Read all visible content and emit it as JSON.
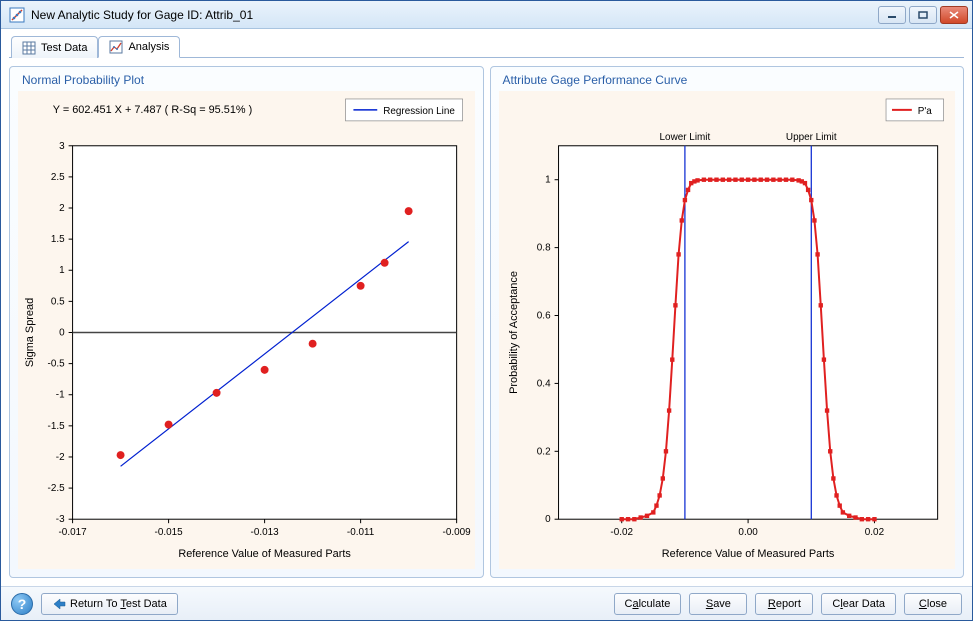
{
  "window": {
    "title": "New Analytic Study for Gage ID:  Attrib_01"
  },
  "tabs": {
    "test_data": "Test Data",
    "analysis": "Analysis"
  },
  "left_panel": {
    "title": "Normal Probability Plot",
    "equation": "Y =  602.451 X + 7.487  ( R-Sq = 95.51% )",
    "legend_label": "Regression Line",
    "xlabel": "Reference Value of Measured Parts",
    "ylabel": "Sigma Spread"
  },
  "right_panel": {
    "title": "Attribute Gage Performance Curve",
    "legend_label": "P'a",
    "xlabel": "Reference Value of Measured Parts",
    "ylabel": "Probability of Acceptance",
    "lower_limit_label": "Lower Limit",
    "upper_limit_label": "Upper Limit"
  },
  "buttons": {
    "return": "Return To Test Data",
    "calculate": "Calculate",
    "save": "Save",
    "report": "Report",
    "clear_data": "Clear Data",
    "close": "Close"
  },
  "chart_data": [
    {
      "type": "scatter",
      "title": "Normal Probability Plot",
      "xlabel": "Reference Value of Measured Parts",
      "ylabel": "Sigma Spread",
      "xlim": [
        -0.017,
        -0.009
      ],
      "ylim": [
        -3,
        3
      ],
      "xticks": [
        -0.017,
        -0.015,
        -0.013,
        -0.011,
        -0.009
      ],
      "yticks": [
        -3,
        -2.5,
        -2,
        -1.5,
        -1,
        -0.5,
        0,
        0.5,
        1,
        1.5,
        2,
        2.5,
        3
      ],
      "series": [
        {
          "name": "Regression Line",
          "type": "line",
          "color": "#0020d0",
          "x": [
            -0.016,
            -0.01
          ],
          "y": [
            -2.15,
            1.46
          ]
        },
        {
          "name": "Points",
          "type": "scatter",
          "color": "#e02020",
          "x": [
            -0.016,
            -0.015,
            -0.014,
            -0.013,
            -0.012,
            -0.011,
            -0.0105,
            -0.01
          ],
          "y": [
            -1.97,
            -1.48,
            -0.97,
            -0.6,
            -0.18,
            0.75,
            1.12,
            1.95
          ]
        },
        {
          "name": "zero-line",
          "type": "hline",
          "color": "#444444",
          "y": 0
        }
      ],
      "equation": "Y = 602.451 X + 7.487 (R-Sq = 95.51%)"
    },
    {
      "type": "line",
      "title": "Attribute Gage Performance Curve",
      "xlabel": "Reference Value of Measured Parts",
      "ylabel": "Probability of Acceptance",
      "xlim": [
        -0.03,
        0.03
      ],
      "ylim": [
        0,
        1.1
      ],
      "xticks": [
        -0.02,
        0.0,
        0.02
      ],
      "yticks": [
        0,
        0.2,
        0.4,
        0.6,
        0.8,
        1
      ],
      "lower_limit": -0.01,
      "upper_limit": 0.01,
      "series": [
        {
          "name": "P'a",
          "color": "#e02020",
          "x": [
            -0.02,
            -0.019,
            -0.018,
            -0.017,
            -0.016,
            -0.015,
            -0.0145,
            -0.014,
            -0.0135,
            -0.013,
            -0.0125,
            -0.012,
            -0.0115,
            -0.011,
            -0.0105,
            -0.01,
            -0.0095,
            -0.009,
            -0.0085,
            -0.008,
            -0.007,
            -0.006,
            -0.005,
            -0.004,
            -0.003,
            -0.002,
            -0.001,
            0.0,
            0.001,
            0.002,
            0.003,
            0.004,
            0.005,
            0.006,
            0.007,
            0.008,
            0.0085,
            0.009,
            0.0095,
            0.01,
            0.0105,
            0.011,
            0.0115,
            0.012,
            0.0125,
            0.013,
            0.0135,
            0.014,
            0.0145,
            0.015,
            0.016,
            0.017,
            0.018,
            0.019,
            0.02
          ],
          "y": [
            0.0,
            0.0,
            0.0,
            0.005,
            0.01,
            0.02,
            0.04,
            0.07,
            0.12,
            0.2,
            0.32,
            0.47,
            0.63,
            0.78,
            0.88,
            0.94,
            0.97,
            0.99,
            0.995,
            0.998,
            1.0,
            1.0,
            1.0,
            1.0,
            1.0,
            1.0,
            1.0,
            1.0,
            1.0,
            1.0,
            1.0,
            1.0,
            1.0,
            1.0,
            1.0,
            0.998,
            0.995,
            0.99,
            0.97,
            0.94,
            0.88,
            0.78,
            0.63,
            0.47,
            0.32,
            0.2,
            0.12,
            0.07,
            0.04,
            0.02,
            0.01,
            0.005,
            0.0,
            0.0,
            0.0
          ]
        }
      ]
    }
  ]
}
